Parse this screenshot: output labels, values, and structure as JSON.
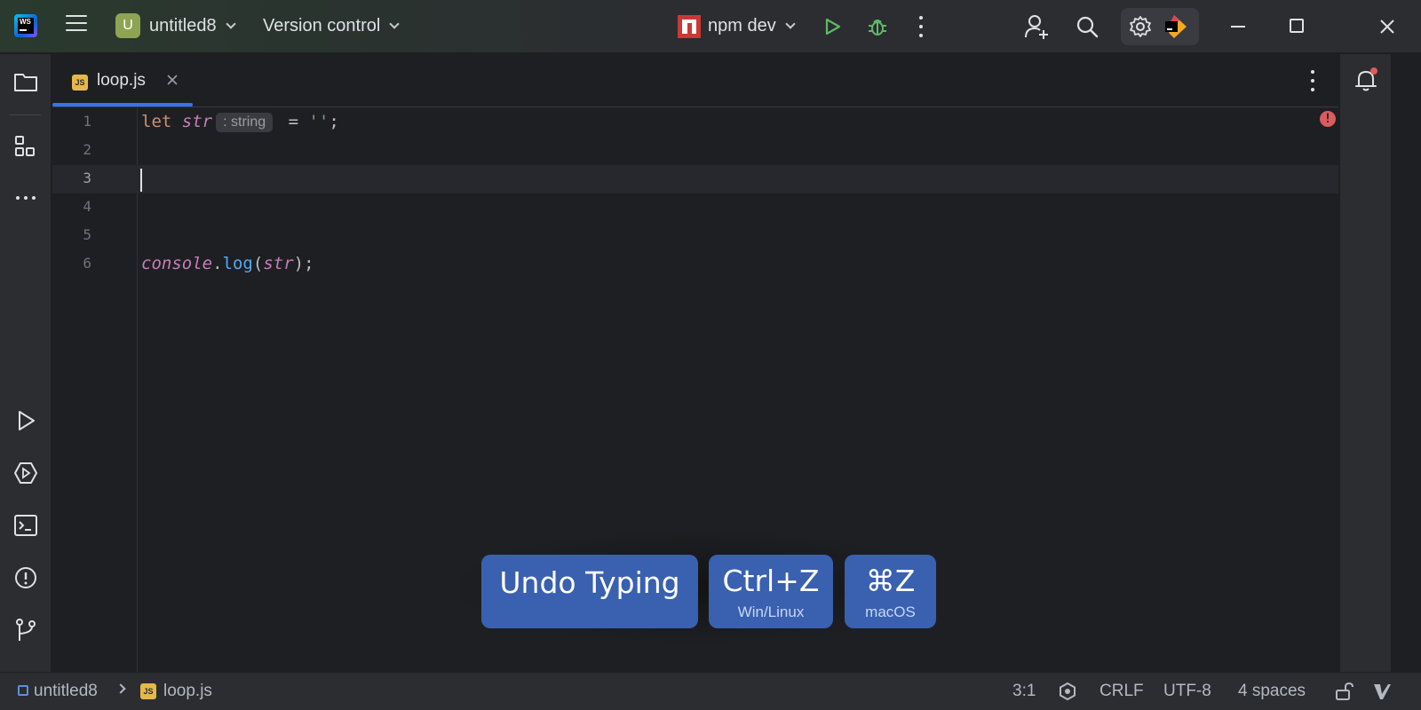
{
  "titlebar": {
    "project_badge": "U",
    "project_name": "untitled8",
    "vcs_label": "Version control",
    "run_config": "npm dev"
  },
  "tab": {
    "badge": "JS",
    "file_name": "loop.js"
  },
  "editor": {
    "lines": [
      {
        "num": "1"
      },
      {
        "num": "2"
      },
      {
        "num": "3"
      },
      {
        "num": "4"
      },
      {
        "num": "5"
      },
      {
        "num": "6"
      }
    ],
    "line1": {
      "kw": "let",
      "var": "str",
      "hint": ": string",
      "rest1": " = ",
      "str": "''",
      "rest2": ";"
    },
    "line6": {
      "obj": "console",
      "dot": ".",
      "fn": "log",
      "open": "(",
      "arg": "str",
      "close": ");"
    },
    "error_glyph": "!"
  },
  "overlay": {
    "action": "Undo Typing",
    "win_key": "Ctrl+Z",
    "win_label": "Win/Linux",
    "mac_key": "⌘Z",
    "mac_label": "macOS"
  },
  "statusbar": {
    "breadcrumb_project": "untitled8",
    "breadcrumb_file": "loop.js",
    "js_badge": "JS",
    "position": "3:1",
    "line_ending": "CRLF",
    "encoding": "UTF-8",
    "indent": "4 spaces"
  },
  "colors": {
    "accent": "#3574f0",
    "overlay_key": "#3a60b0",
    "project_badge": "#8ea453",
    "run_green": "#5fb865",
    "error_red": "#db5c5c"
  }
}
